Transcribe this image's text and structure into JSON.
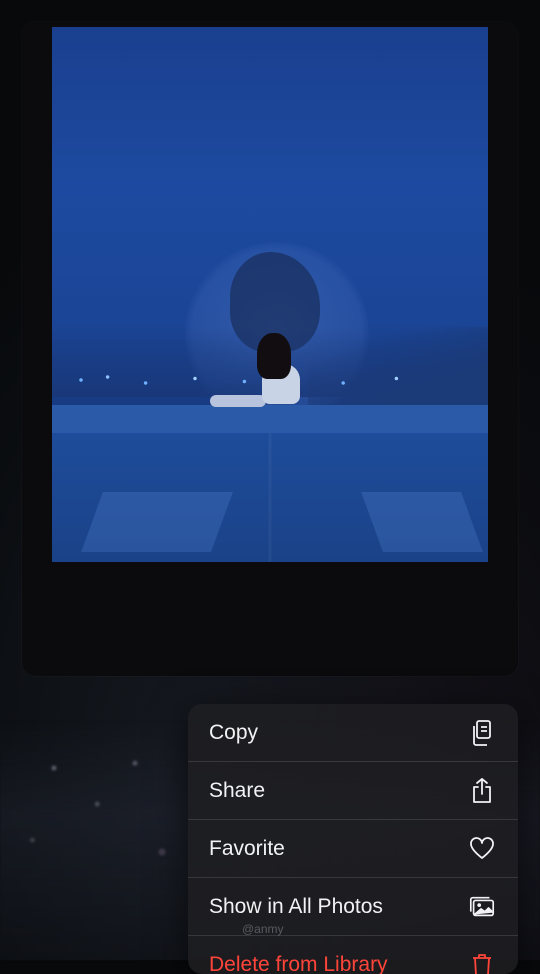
{
  "photo": {
    "alt": "girl sitting on rooftop at night"
  },
  "context_menu": {
    "items": [
      {
        "label": "Copy",
        "icon": "copy-icon"
      },
      {
        "label": "Share",
        "icon": "share-icon"
      },
      {
        "label": "Favorite",
        "icon": "heart-icon"
      },
      {
        "label": "Show in All Photos",
        "icon": "photos-icon"
      },
      {
        "label": "Delete from Library",
        "icon": "trash-icon",
        "destructive": true
      }
    ]
  },
  "watermark": "@anmy",
  "colors": {
    "destructive": "#ff453a",
    "menu_bg": "#1e1e22",
    "photo_blue": "#1d4aa0"
  }
}
